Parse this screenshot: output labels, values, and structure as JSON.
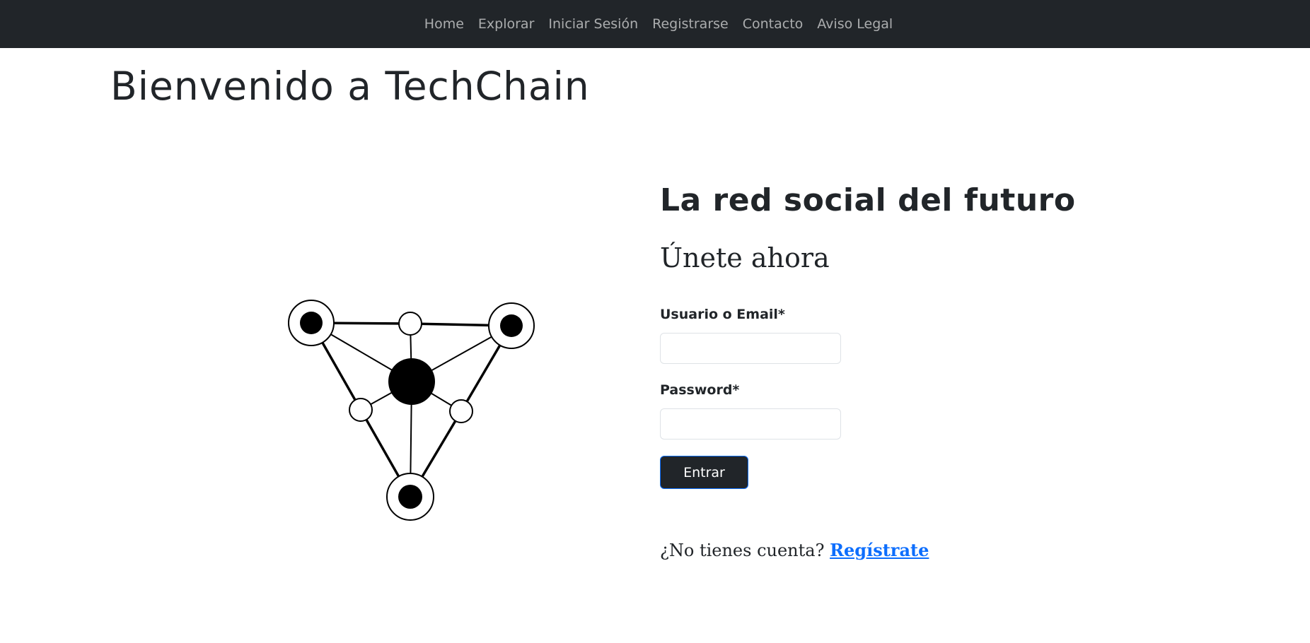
{
  "nav": {
    "items": [
      {
        "label": "Home"
      },
      {
        "label": "Explorar"
      },
      {
        "label": "Iniciar Sesión"
      },
      {
        "label": "Registrarse"
      },
      {
        "label": "Contacto"
      },
      {
        "label": "Aviso Legal"
      }
    ]
  },
  "header": {
    "title": "Bienvenido a TechChain"
  },
  "hero": {
    "logo_icon": "network-graph-icon"
  },
  "login": {
    "tagline": "La red social del futuro",
    "join_heading": "Únete ahora",
    "user_label": "Usuario o Email*",
    "user_value": "",
    "password_label": "Password*",
    "password_value": "",
    "submit_label": "Entrar",
    "no_account_text": "¿No tienes cuenta?",
    "signup_link": "Regístrate"
  },
  "colors": {
    "navbar_bg": "#212529",
    "nav_text": "#9a9da0",
    "button_bg": "#212529",
    "link": "#0d6efd",
    "text": "#212529"
  }
}
